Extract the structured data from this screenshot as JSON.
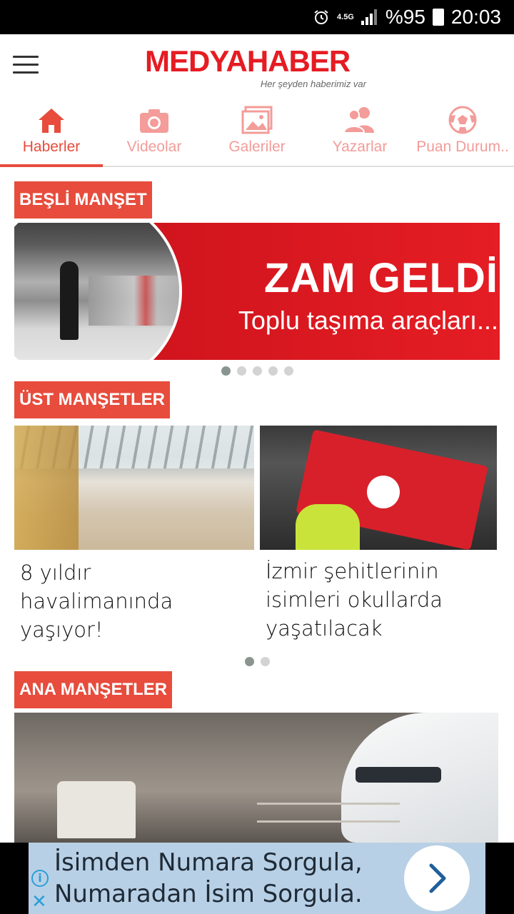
{
  "status_bar": {
    "network": "4.5G",
    "battery": "%95",
    "time": "20:03"
  },
  "header": {
    "logo": "MEDYAHABER",
    "tagline": "Her şeyden haberimiz var"
  },
  "tabs": [
    {
      "label": "Haberler",
      "icon": "home-icon",
      "active": true
    },
    {
      "label": "Videolar",
      "icon": "camera-icon",
      "active": false
    },
    {
      "label": "Galeriler",
      "icon": "gallery-icon",
      "active": false
    },
    {
      "label": "Yazarlar",
      "icon": "users-icon",
      "active": false
    },
    {
      "label": "Puan Durum..",
      "icon": "football-icon",
      "active": false
    }
  ],
  "sections": {
    "besli": {
      "title": "BEŞLİ MANŞET",
      "slide": {
        "headline": "ZAM GELDİ",
        "subtitle": "Toplu taşıma araçları..."
      },
      "dots_total": 5,
      "dots_active": 0
    },
    "ust": {
      "title": "ÜST MANŞETLER",
      "cards": [
        {
          "title": "8 yıldır havalimanında yaşıyor!"
        },
        {
          "title": "İzmir şehitlerinin isimleri okullarda yaşatılacak"
        }
      ],
      "dots_total": 2,
      "dots_active": 0
    },
    "ana": {
      "title": "ANA MANŞETLER"
    }
  },
  "ad": {
    "line1": "İsimden Numara Sorgula,",
    "line2": "Numaradan İsim Sorgula."
  },
  "colors": {
    "accent": "#e74c3c",
    "tab_inactive": "#f39c99",
    "logo": "#e51c23"
  }
}
